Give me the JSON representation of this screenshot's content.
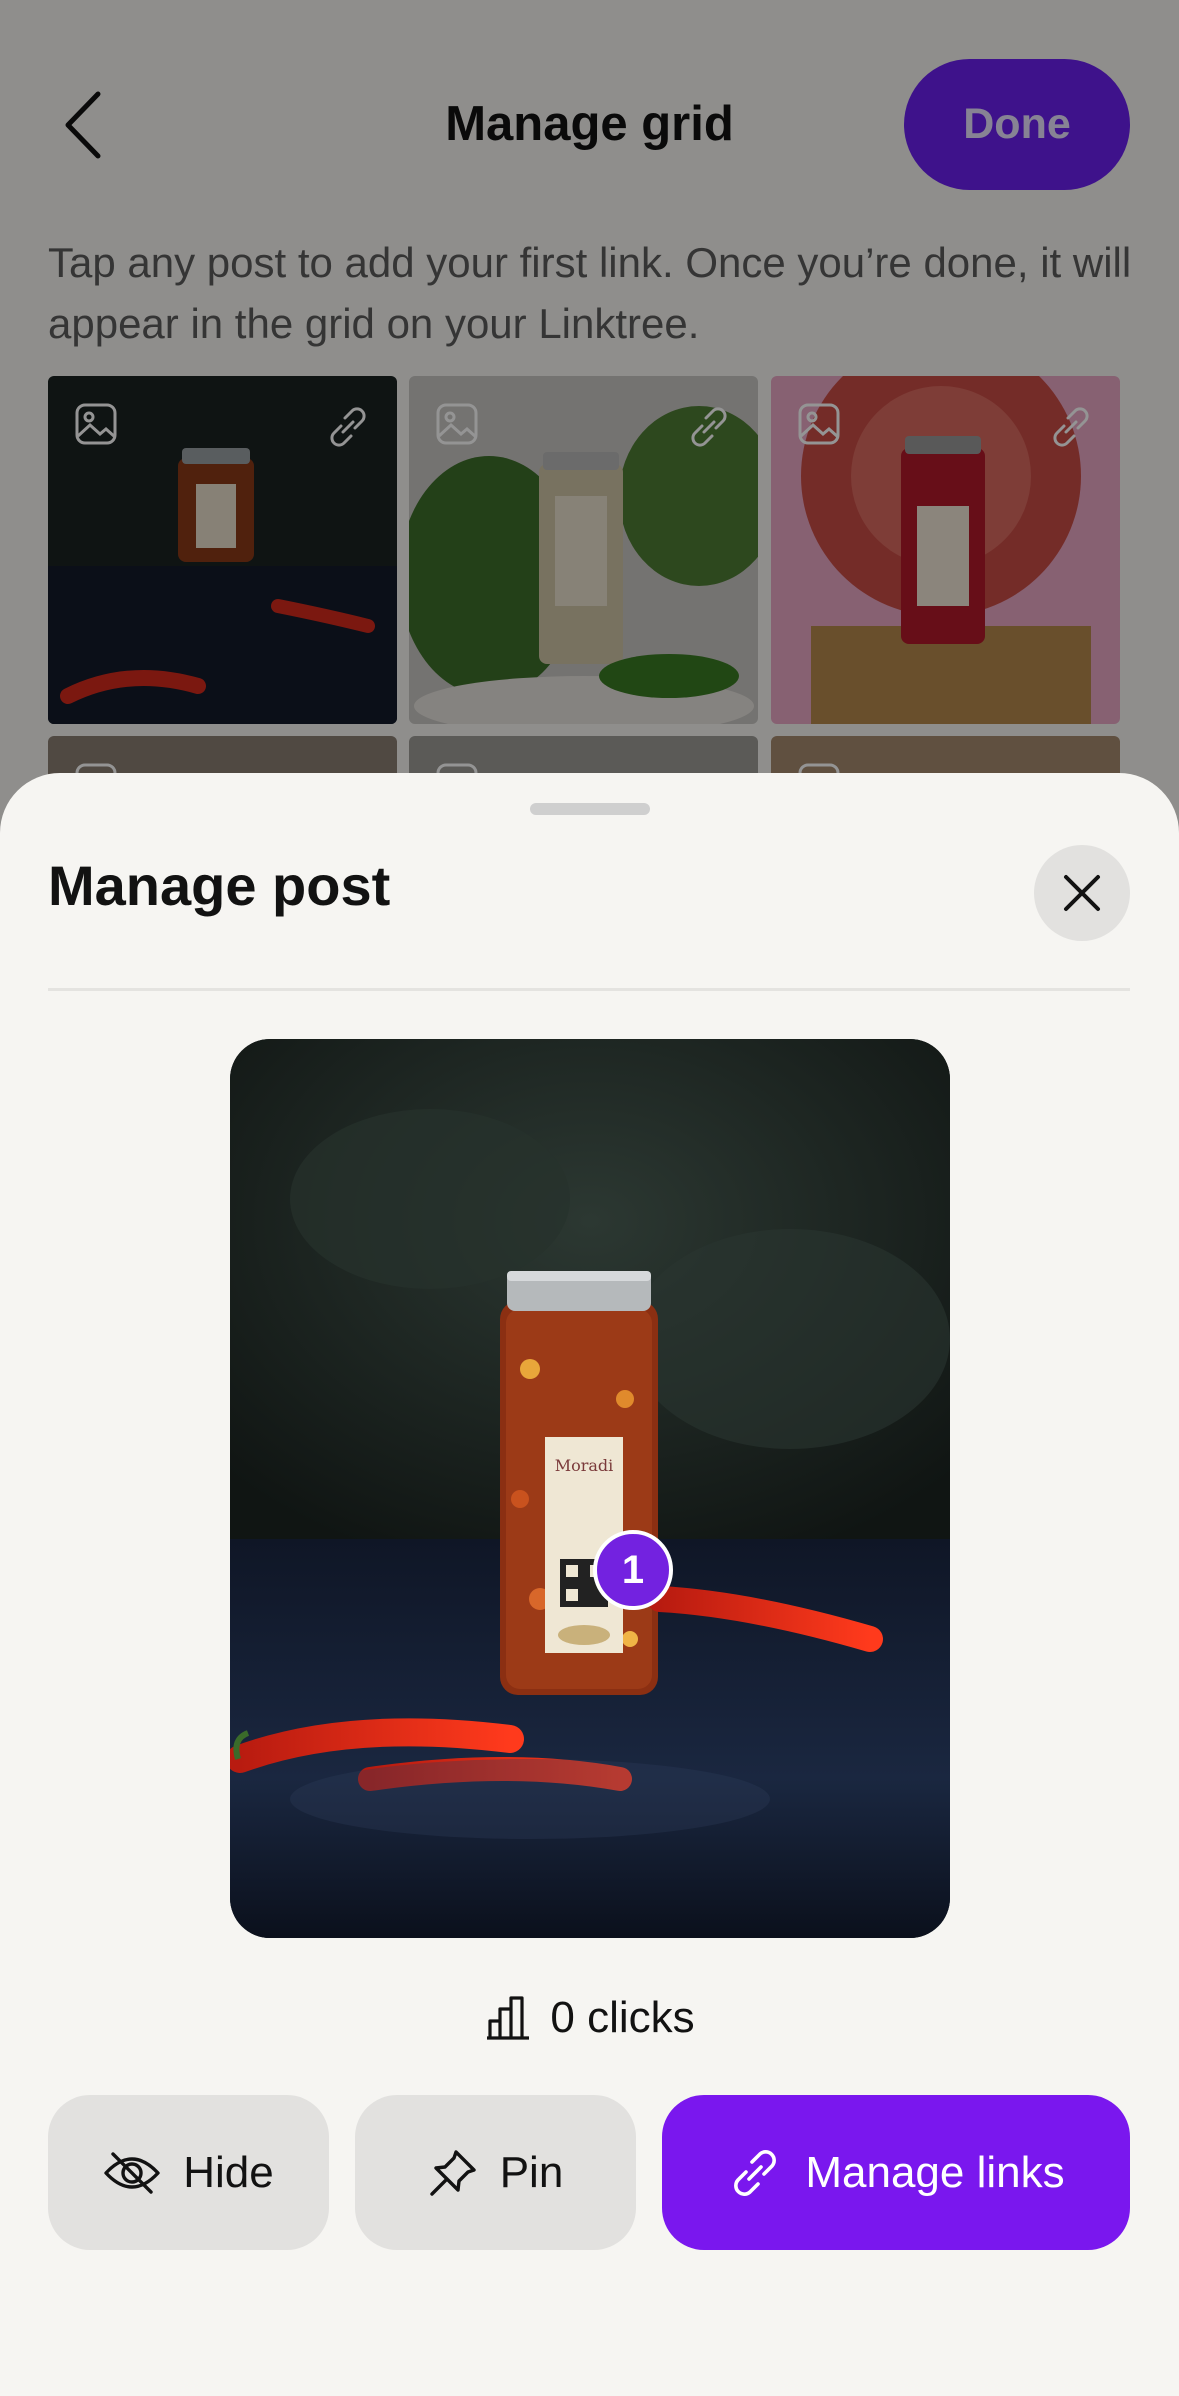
{
  "header": {
    "title": "Manage grid",
    "done_label": "Done",
    "instructions": "Tap any post to add your first link. Once you’re done, it will appear in the grid on your Linktree."
  },
  "grid": {
    "posts": [
      {
        "type_icon": "image-icon",
        "link_icon": "link-icon"
      },
      {
        "type_icon": "image-icon",
        "link_icon": "link-icon"
      },
      {
        "type_icon": "image-icon",
        "link_icon": "link-icon"
      },
      {
        "type_icon": "image-icon",
        "link_icon": "link-icon"
      },
      {
        "type_icon": "image-icon",
        "link_icon": "link-icon"
      },
      {
        "type_icon": "image-icon",
        "link_icon": "link-icon"
      }
    ]
  },
  "sheet": {
    "title": "Manage post",
    "link_marker": "1",
    "clicks": "0 clicks",
    "actions": {
      "hide": "Hide",
      "pin": "Pin",
      "manage_links": "Manage links"
    }
  },
  "colors": {
    "accent": "#7a17ee",
    "background": "#f6f5f2",
    "button_secondary": "#e2e1df"
  }
}
